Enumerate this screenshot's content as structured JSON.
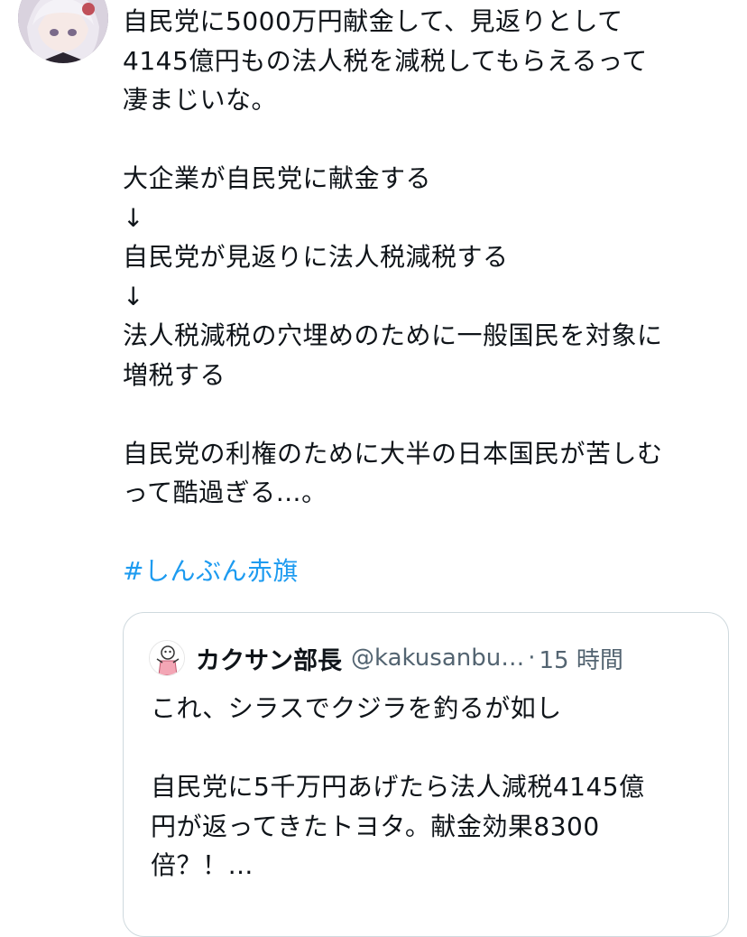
{
  "tweet": {
    "lines": [
      "自民党に5000万円献金して、見返りとして",
      "4145億円もの法人税を減税してもらえるって",
      "凄まじいな。",
      "",
      "大企業が自民党に献金する",
      "↓",
      "自民党が見返りに法人税減税する",
      "↓",
      "法人税減税の穴埋めのために一般国民を対象に",
      "増税する",
      "",
      "自民党の利権のために大半の日本国民が苦しむ",
      "って酷過ぎる…。"
    ],
    "hashtag": "#しんぶん赤旗",
    "avatar_icon": "user-avatar-icon"
  },
  "quote": {
    "author_name": "カクサン部長",
    "handle": "@kakusanbu…",
    "separator": "·",
    "time": "15 時間",
    "avatar_icon": "quoted-user-avatar-icon",
    "lines": [
      "これ、シラスでクジラを釣るが如し",
      "",
      "自民党に5千万円あげたら法人減税4145億",
      "円が返ってきたトヨタ。献金効果8300",
      "倍？！…"
    ]
  },
  "colors": {
    "text": "#0f1419",
    "link": "#1d9bf0",
    "secondary": "#536471",
    "border": "#cfd9de"
  }
}
